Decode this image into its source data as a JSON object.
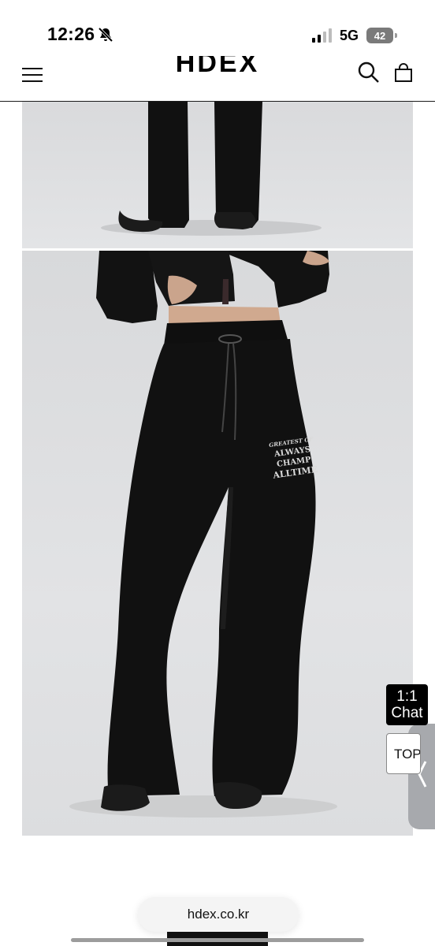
{
  "status_bar": {
    "time": "12:26",
    "network": "5G",
    "battery_level": "42",
    "icons": [
      "bell-slash-icon",
      "signal-icon",
      "battery-icon"
    ]
  },
  "header": {
    "logo": "HDEX",
    "icons": [
      "menu-icon",
      "search-icon",
      "shopping-bag-icon"
    ]
  },
  "product": {
    "print_line1": "GREATEST OF",
    "print_line2": "ALWAYS CHAMP",
    "print_line3": "ALLTIME"
  },
  "floating": {
    "chat_line1": "1:1",
    "chat_line2": "Chat",
    "top_label": "TOP"
  },
  "browser": {
    "url": "hdex.co.kr"
  },
  "colors": {
    "photo_background": "#dfe0e2",
    "garment": "#111111",
    "accent_black": "#000000",
    "side_tab": "#a7a9ad"
  }
}
